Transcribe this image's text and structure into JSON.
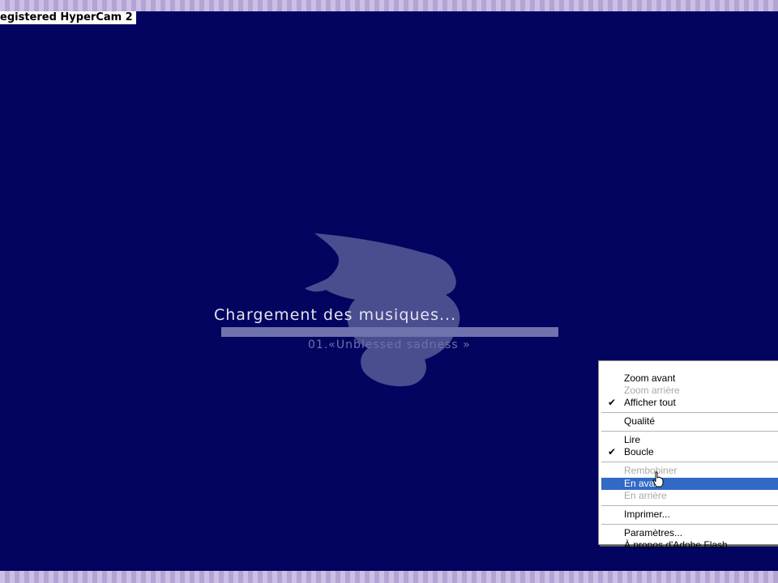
{
  "watermark": {
    "text": "egistered HyperCam 2"
  },
  "colors": {
    "stage_background": "#02045f",
    "menu_highlight": "#316ac5",
    "frame": "#b9acd6"
  },
  "loader": {
    "title": "Chargement des musiques...",
    "track": "01.«Unblessed sadness »",
    "progress_percent": 100
  },
  "context_menu": {
    "items": [
      {
        "label": "Zoom avant",
        "enabled": true,
        "checked": false
      },
      {
        "label": "Zoom arrière",
        "enabled": false,
        "checked": false
      },
      {
        "label": "Afficher tout",
        "enabled": true,
        "checked": true
      },
      {
        "label": "Qualité",
        "enabled": true,
        "checked": false
      },
      {
        "label": "Lire",
        "enabled": true,
        "checked": false
      },
      {
        "label": "Boucle",
        "enabled": true,
        "checked": true
      },
      {
        "label": "Rembobiner",
        "enabled": false,
        "checked": false
      },
      {
        "label": "En avant",
        "enabled": true,
        "checked": false,
        "highlighted": true
      },
      {
        "label": "En arrière",
        "enabled": false,
        "checked": false
      },
      {
        "label": "Imprimer...",
        "enabled": true,
        "checked": false
      },
      {
        "label": "Paramètres...",
        "enabled": true,
        "checked": false
      },
      {
        "label": "À propos d'Adobe Flash",
        "enabled": true,
        "checked": false
      }
    ],
    "check_glyph": "✔"
  },
  "icons": {
    "cursor": "hand-pointer-icon",
    "logo": "witch-hat-logo-icon"
  }
}
